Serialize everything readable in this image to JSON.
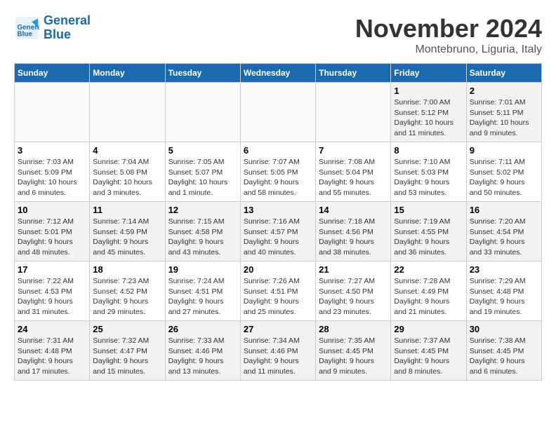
{
  "header": {
    "logo_line1": "General",
    "logo_line2": "Blue",
    "month": "November 2024",
    "location": "Montebruno, Liguria, Italy"
  },
  "weekdays": [
    "Sunday",
    "Monday",
    "Tuesday",
    "Wednesday",
    "Thursday",
    "Friday",
    "Saturday"
  ],
  "weeks": [
    [
      {
        "day": "",
        "info": ""
      },
      {
        "day": "",
        "info": ""
      },
      {
        "day": "",
        "info": ""
      },
      {
        "day": "",
        "info": ""
      },
      {
        "day": "",
        "info": ""
      },
      {
        "day": "1",
        "info": "Sunrise: 7:00 AM\nSunset: 5:12 PM\nDaylight: 10 hours and 11 minutes."
      },
      {
        "day": "2",
        "info": "Sunrise: 7:01 AM\nSunset: 5:11 PM\nDaylight: 10 hours and 9 minutes."
      }
    ],
    [
      {
        "day": "3",
        "info": "Sunrise: 7:03 AM\nSunset: 5:09 PM\nDaylight: 10 hours and 6 minutes."
      },
      {
        "day": "4",
        "info": "Sunrise: 7:04 AM\nSunset: 5:08 PM\nDaylight: 10 hours and 3 minutes."
      },
      {
        "day": "5",
        "info": "Sunrise: 7:05 AM\nSunset: 5:07 PM\nDaylight: 10 hours and 1 minute."
      },
      {
        "day": "6",
        "info": "Sunrise: 7:07 AM\nSunset: 5:05 PM\nDaylight: 9 hours and 58 minutes."
      },
      {
        "day": "7",
        "info": "Sunrise: 7:08 AM\nSunset: 5:04 PM\nDaylight: 9 hours and 55 minutes."
      },
      {
        "day": "8",
        "info": "Sunrise: 7:10 AM\nSunset: 5:03 PM\nDaylight: 9 hours and 53 minutes."
      },
      {
        "day": "9",
        "info": "Sunrise: 7:11 AM\nSunset: 5:02 PM\nDaylight: 9 hours and 50 minutes."
      }
    ],
    [
      {
        "day": "10",
        "info": "Sunrise: 7:12 AM\nSunset: 5:01 PM\nDaylight: 9 hours and 48 minutes."
      },
      {
        "day": "11",
        "info": "Sunrise: 7:14 AM\nSunset: 4:59 PM\nDaylight: 9 hours and 45 minutes."
      },
      {
        "day": "12",
        "info": "Sunrise: 7:15 AM\nSunset: 4:58 PM\nDaylight: 9 hours and 43 minutes."
      },
      {
        "day": "13",
        "info": "Sunrise: 7:16 AM\nSunset: 4:57 PM\nDaylight: 9 hours and 40 minutes."
      },
      {
        "day": "14",
        "info": "Sunrise: 7:18 AM\nSunset: 4:56 PM\nDaylight: 9 hours and 38 minutes."
      },
      {
        "day": "15",
        "info": "Sunrise: 7:19 AM\nSunset: 4:55 PM\nDaylight: 9 hours and 36 minutes."
      },
      {
        "day": "16",
        "info": "Sunrise: 7:20 AM\nSunset: 4:54 PM\nDaylight: 9 hours and 33 minutes."
      }
    ],
    [
      {
        "day": "17",
        "info": "Sunrise: 7:22 AM\nSunset: 4:53 PM\nDaylight: 9 hours and 31 minutes."
      },
      {
        "day": "18",
        "info": "Sunrise: 7:23 AM\nSunset: 4:52 PM\nDaylight: 9 hours and 29 minutes."
      },
      {
        "day": "19",
        "info": "Sunrise: 7:24 AM\nSunset: 4:51 PM\nDaylight: 9 hours and 27 minutes."
      },
      {
        "day": "20",
        "info": "Sunrise: 7:26 AM\nSunset: 4:51 PM\nDaylight: 9 hours and 25 minutes."
      },
      {
        "day": "21",
        "info": "Sunrise: 7:27 AM\nSunset: 4:50 PM\nDaylight: 9 hours and 23 minutes."
      },
      {
        "day": "22",
        "info": "Sunrise: 7:28 AM\nSunset: 4:49 PM\nDaylight: 9 hours and 21 minutes."
      },
      {
        "day": "23",
        "info": "Sunrise: 7:29 AM\nSunset: 4:48 PM\nDaylight: 9 hours and 19 minutes."
      }
    ],
    [
      {
        "day": "24",
        "info": "Sunrise: 7:31 AM\nSunset: 4:48 PM\nDaylight: 9 hours and 17 minutes."
      },
      {
        "day": "25",
        "info": "Sunrise: 7:32 AM\nSunset: 4:47 PM\nDaylight: 9 hours and 15 minutes."
      },
      {
        "day": "26",
        "info": "Sunrise: 7:33 AM\nSunset: 4:46 PM\nDaylight: 9 hours and 13 minutes."
      },
      {
        "day": "27",
        "info": "Sunrise: 7:34 AM\nSunset: 4:46 PM\nDaylight: 9 hours and 11 minutes."
      },
      {
        "day": "28",
        "info": "Sunrise: 7:35 AM\nSunset: 4:45 PM\nDaylight: 9 hours and 9 minutes."
      },
      {
        "day": "29",
        "info": "Sunrise: 7:37 AM\nSunset: 4:45 PM\nDaylight: 9 hours and 8 minutes."
      },
      {
        "day": "30",
        "info": "Sunrise: 7:38 AM\nSunset: 4:45 PM\nDaylight: 9 hours and 6 minutes."
      }
    ]
  ]
}
